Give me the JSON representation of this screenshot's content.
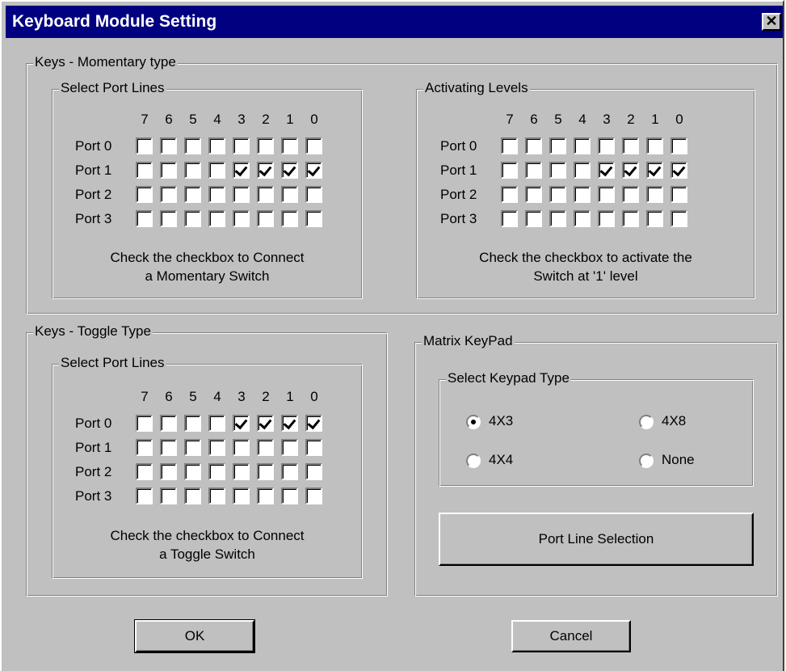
{
  "window": {
    "title": "Keyboard Module Setting",
    "close_label": "✕"
  },
  "bits": [
    "7",
    "6",
    "5",
    "4",
    "3",
    "2",
    "1",
    "0"
  ],
  "ports": [
    "Port 0",
    "Port 1",
    "Port 2",
    "Port 3"
  ],
  "momentary": {
    "title": "Keys - Momentary type",
    "select": {
      "title": "Select Port Lines",
      "checked": [
        [
          0,
          0,
          0,
          0,
          0,
          0,
          0,
          0
        ],
        [
          0,
          0,
          0,
          0,
          1,
          1,
          1,
          1
        ],
        [
          0,
          0,
          0,
          0,
          0,
          0,
          0,
          0
        ],
        [
          0,
          0,
          0,
          0,
          0,
          0,
          0,
          0
        ]
      ],
      "hint_line1": "Check the checkbox to Connect",
      "hint_line2": "a Momentary Switch"
    },
    "levels": {
      "title": "Activating Levels",
      "checked": [
        [
          0,
          0,
          0,
          0,
          0,
          0,
          0,
          0
        ],
        [
          0,
          0,
          0,
          0,
          1,
          1,
          1,
          1
        ],
        [
          0,
          0,
          0,
          0,
          0,
          0,
          0,
          0
        ],
        [
          0,
          0,
          0,
          0,
          0,
          0,
          0,
          0
        ]
      ],
      "hint_line1": "Check the checkbox to activate the",
      "hint_line2": "Switch at '1' level"
    }
  },
  "toggle": {
    "title": "Keys - Toggle Type",
    "select": {
      "title": "Select Port Lines",
      "checked": [
        [
          0,
          0,
          0,
          0,
          1,
          1,
          1,
          1
        ],
        [
          0,
          0,
          0,
          0,
          0,
          0,
          0,
          0
        ],
        [
          0,
          0,
          0,
          0,
          0,
          0,
          0,
          0
        ],
        [
          0,
          0,
          0,
          0,
          0,
          0,
          0,
          0
        ]
      ],
      "hint_line1": "Check the checkbox to Connect",
      "hint_line2": "a Toggle Switch"
    }
  },
  "matrix": {
    "title": "Matrix KeyPad",
    "keypad_title": "Select Keypad Type",
    "options": [
      {
        "label": "4X3",
        "selected": true
      },
      {
        "label": "4X8",
        "selected": false
      },
      {
        "label": "4X4",
        "selected": false
      },
      {
        "label": "None",
        "selected": false
      }
    ],
    "port_line_button": "Port Line Selection"
  },
  "footer": {
    "ok_label": "OK",
    "cancel_label": "Cancel"
  }
}
